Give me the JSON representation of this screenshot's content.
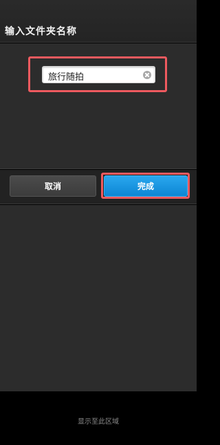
{
  "dialog": {
    "title": "输入文件夹名称",
    "folder_name": "旅行随拍",
    "cancel_label": "取消",
    "done_label": "完成"
  },
  "footer": {
    "hint": "显示至此区域"
  },
  "colors": {
    "accent": "#0d86d4",
    "highlight": "#ef5a5f",
    "background": "#2c2c2c"
  },
  "icons": {
    "clear": "clear-icon"
  }
}
